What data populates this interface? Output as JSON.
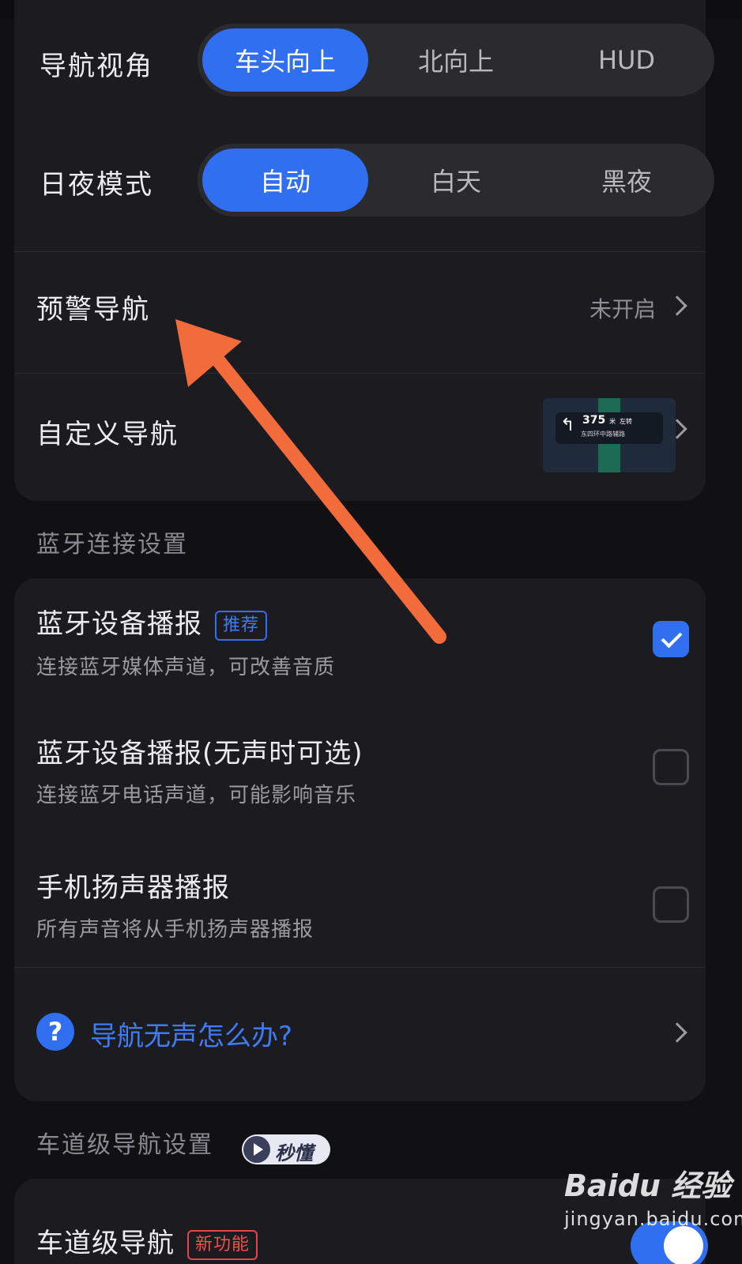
{
  "top_clip_text": "",
  "nav_view": {
    "label": "导航视角",
    "options": [
      "车头向上",
      "北向上",
      "HUD"
    ],
    "selected": "车头向上"
  },
  "day_night": {
    "label": "日夜模式",
    "options": [
      "自动",
      "白天",
      "黑夜"
    ],
    "selected": "自动"
  },
  "early_warning": {
    "label": "预警导航",
    "status": "未开启"
  },
  "custom_nav": {
    "label": "自定义导航",
    "preview": {
      "distance": "375",
      "unit": "米",
      "action": "左转",
      "road": "东四环中路辅路"
    }
  },
  "bluetooth_section": {
    "title": "蓝牙连接设置",
    "options": [
      {
        "title": "蓝牙设备播报",
        "badge": "推荐",
        "desc": "连接蓝牙媒体声道，可改善音质",
        "checked": true
      },
      {
        "title": "蓝牙设备播报(无声时可选)",
        "desc": "连接蓝牙电话声道，可能影响音乐",
        "checked": false
      },
      {
        "title": "手机扬声器播报",
        "desc": "所有声音将从手机扬声器播报",
        "checked": false
      }
    ],
    "help": "导航无声怎么办?"
  },
  "lane_section": {
    "title": "车道级导航设置",
    "video_badge": "秒懂",
    "lane_nav": {
      "title": "车道级导航",
      "badge": "新功能",
      "enabled": true
    }
  },
  "watermark": {
    "brand": "Baidu 经验",
    "url": "jingyan.baidu.com"
  },
  "colors": {
    "accent": "#2f6ff0",
    "arrow": "#f26b3a",
    "background": "#111114",
    "card": "#1c1c20"
  },
  "icons": [
    "chevron-right-icon",
    "checkmark-icon",
    "question-icon",
    "play-icon",
    "turn-left-arrow-icon"
  ]
}
